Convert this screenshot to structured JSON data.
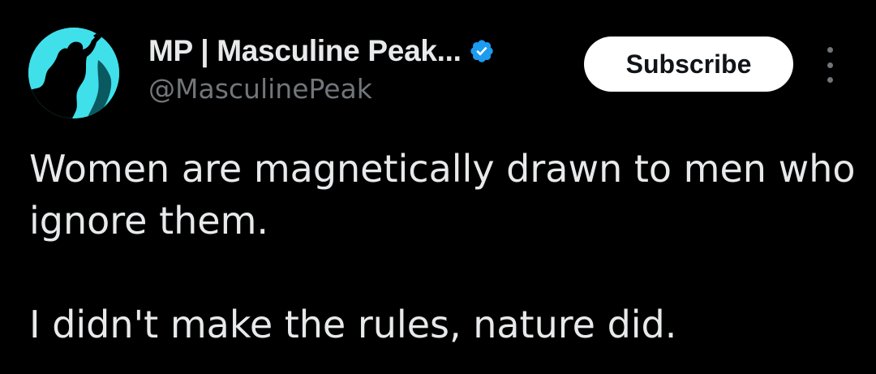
{
  "tweet": {
    "author": {
      "display_name": "MP | Masculine Peak...",
      "handle": "@MasculinePeak",
      "verified": true,
      "avatar_icon": "climber-silhouette-icon",
      "avatar_color": "#3fe0ea"
    },
    "subscribe_label": "Subscribe",
    "more_icon": "more-vertical-icon",
    "text_lines": [
      "Women are magnetically drawn to men who ignore them.",
      "I didn't make the rules, nature did."
    ]
  },
  "colors": {
    "background": "#000000",
    "primary_text": "#e7e9ea",
    "secondary_text": "#71767b",
    "verified_blue": "#1d9bf0",
    "button_bg": "#ffffff",
    "button_text": "#0f1419"
  }
}
